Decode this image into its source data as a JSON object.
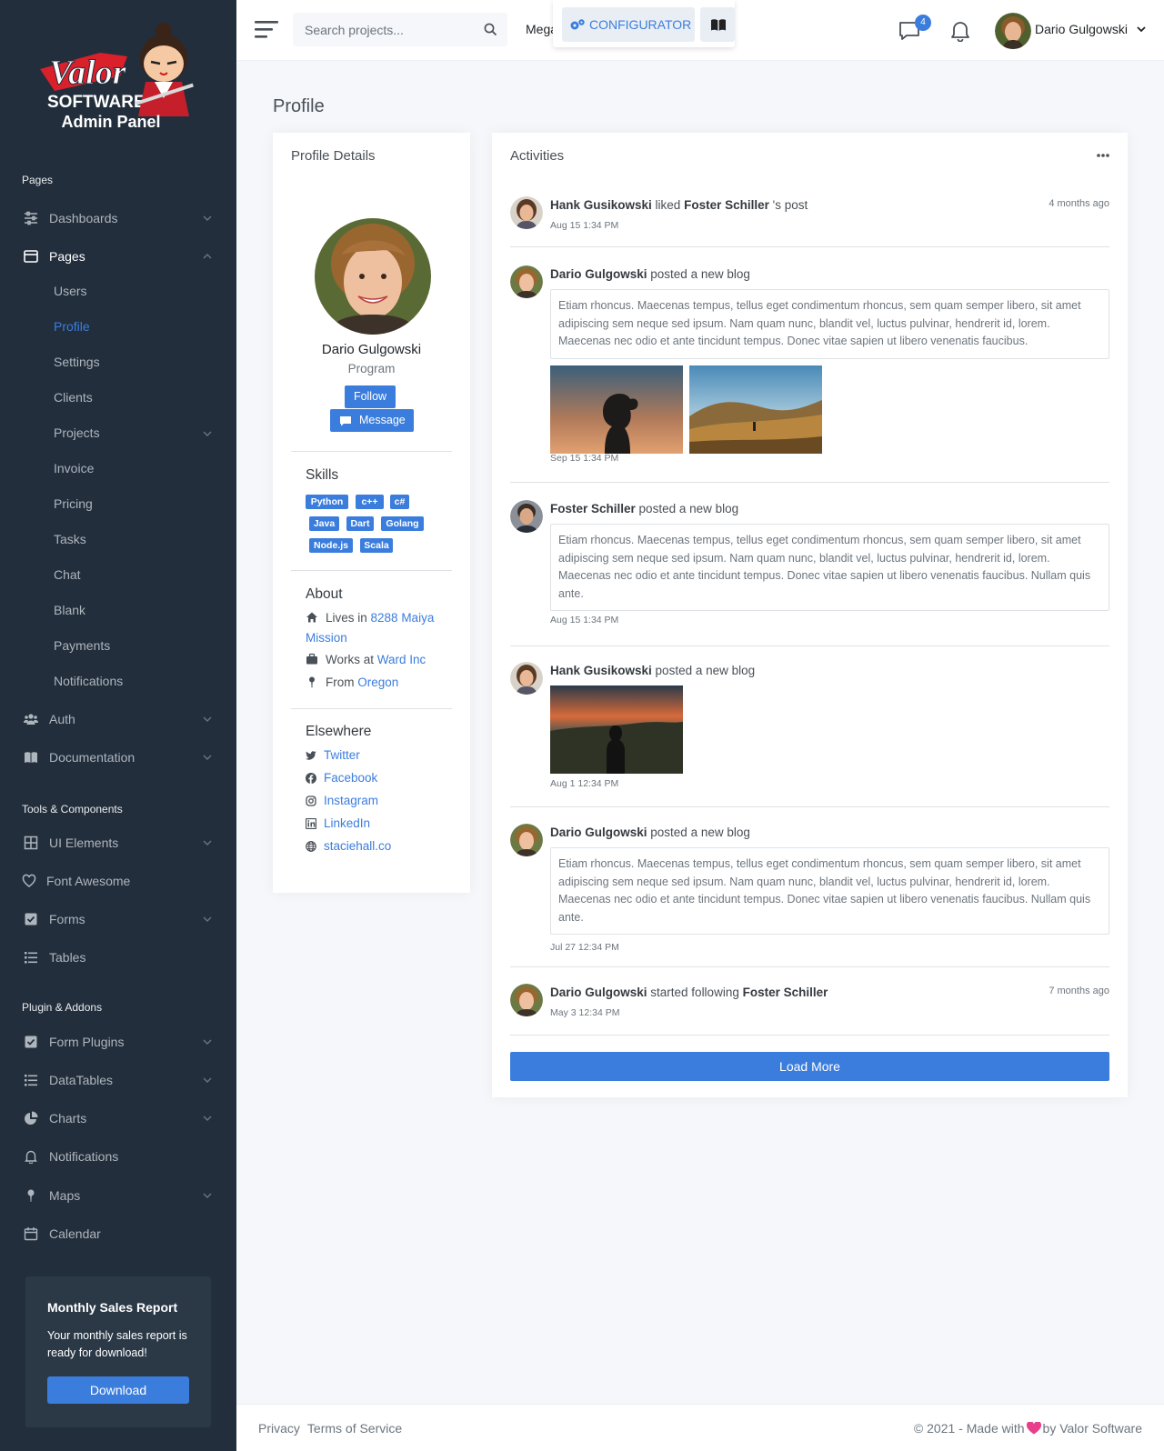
{
  "brand": {
    "logo_text": "Valor",
    "logo_sub": "SOFTWARE",
    "panel_title": "Admin Panel"
  },
  "sidebar": {
    "sections": [
      {
        "header": "Pages"
      },
      {
        "header": "Tools & Components"
      },
      {
        "header": "Plugin & Addons"
      }
    ],
    "pages_items": [
      {
        "label": "Dashboards",
        "icon": "sliders-icon"
      },
      {
        "label": "Pages",
        "icon": "layout-icon"
      }
    ],
    "sub_items": [
      "Users",
      "Profile",
      "Settings",
      "Clients",
      "Projects",
      "Invoice",
      "Pricing",
      "Tasks",
      "Chat",
      "Blank",
      "Payments",
      "Notifications"
    ],
    "more_items": [
      {
        "label": "Auth",
        "icon": "users-icon"
      },
      {
        "label": "Documentation",
        "icon": "book-icon"
      }
    ],
    "tools_items": [
      {
        "label": "UI Elements",
        "icon": "grid-icon"
      },
      {
        "label": "Font Awesome",
        "icon": "heart-icon"
      },
      {
        "label": "Forms",
        "icon": "check-square-icon"
      },
      {
        "label": "Tables",
        "icon": "list-icon"
      }
    ],
    "plugin_items": [
      {
        "label": "Form Plugins",
        "icon": "check-square-icon"
      },
      {
        "label": "DataTables",
        "icon": "list-icon"
      },
      {
        "label": "Charts",
        "icon": "pie-chart-icon"
      },
      {
        "label": "Notifications",
        "icon": "bell-icon"
      },
      {
        "label": "Maps",
        "icon": "map-pin-icon"
      },
      {
        "label": "Calendar",
        "icon": "calendar-icon"
      }
    ],
    "promo": {
      "title": "Monthly Sales Report",
      "text": "Your monthly sales report is ready for download!",
      "button": "Download"
    }
  },
  "topbar": {
    "search_placeholder": "Search projects...",
    "mega": "Mega",
    "configurator": "CONFIGURATOR",
    "messages_count": "4",
    "user_name": "Dario Gulgowski"
  },
  "main": {
    "page_title": "Profile",
    "profile": {
      "card_title": "Profile Details",
      "name": "Dario Gulgowski",
      "role": "Program",
      "follow": "Follow",
      "message": "Message",
      "skills_title": "Skills",
      "skills": [
        "Python",
        "c++",
        "c#",
        "Java",
        "Dart",
        "Golang",
        "Node.js",
        "Scala"
      ],
      "about_title": "About",
      "about": {
        "lives_prefix": "Lives in ",
        "lives_value": "8288 Maiya Mission",
        "works_prefix": "Works at ",
        "works_value": "Ward Inc",
        "from_prefix": "From ",
        "from_value": "Oregon"
      },
      "elsewhere_title": "Elsewhere",
      "elsewhere": [
        {
          "label": "Twitter",
          "icon": "twitter-icon"
        },
        {
          "label": "Facebook",
          "icon": "facebook-icon"
        },
        {
          "label": "Instagram",
          "icon": "instagram-icon"
        },
        {
          "label": "LinkedIn",
          "icon": "linkedin-icon"
        },
        {
          "label": "staciehall.co",
          "icon": "globe-icon"
        }
      ]
    },
    "activities": {
      "card_title": "Activities",
      "items": [
        {
          "actor": "Hank Gusikowski",
          "verb": " liked ",
          "target": "Foster Schiller",
          "suffix": " 's post",
          "time": "Aug 15 1:34 PM",
          "ago": "4 months ago"
        },
        {
          "actor": "Dario Gulgowski",
          "verb": " posted a new blog",
          "text": "Etiam rhoncus. Maecenas tempus, tellus eget condimentum rhoncus, sem quam semper libero, sit amet adipiscing sem neque sed ipsum. Nam quam nunc, blandit vel, luctus pulvinar, hendrerit id, lorem. Maecenas nec odio et ante tincidunt tempus. Donec vitae sapien ut libero venenatis faucibus.",
          "time": "Sep 15 1:34 PM"
        },
        {
          "actor": "Foster Schiller",
          "verb": " posted a new blog",
          "text": "Etiam rhoncus. Maecenas tempus, tellus eget condimentum rhoncus, sem quam semper libero, sit amet adipiscing sem neque sed ipsum. Nam quam nunc, blandit vel, luctus pulvinar, hendrerit id, lorem. Maecenas nec odio et ante tincidunt tempus. Donec vitae sapien ut libero venenatis faucibus. Nullam quis ante.",
          "time": "Aug 15 1:34 PM"
        },
        {
          "actor": "Hank Gusikowski",
          "verb": " posted a new blog",
          "time": "Aug 1 12:34 PM"
        },
        {
          "actor": "Dario Gulgowski",
          "verb": " posted a new blog",
          "text": "Etiam rhoncus. Maecenas tempus, tellus eget condimentum rhoncus, sem quam semper libero, sit amet adipiscing sem neque sed ipsum. Nam quam nunc, blandit vel, luctus pulvinar, hendrerit id, lorem. Maecenas nec odio et ante tincidunt tempus. Donec vitae sapien ut libero venenatis faucibus. Nullam quis ante.",
          "time": "Jul 27 12:34 PM"
        },
        {
          "actor": "Dario Gulgowski",
          "verb": " started following ",
          "target": "Foster Schiller",
          "time": "May 3 12:34 PM",
          "ago": "7 months ago"
        }
      ],
      "load_more": "Load More"
    }
  },
  "footer": {
    "privacy": "Privacy",
    "terms": "Terms of Service",
    "copy_prefix": "© 2021 - Made with",
    "copy_suffix": "by Valor Software"
  },
  "colors": {
    "primary": "#3b7ddd",
    "sidebar": "#222e3c"
  }
}
